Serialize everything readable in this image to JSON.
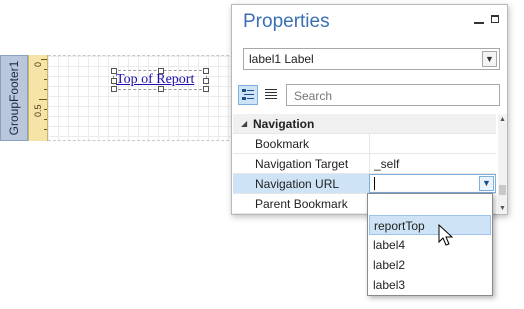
{
  "designer": {
    "band_name": "GroupFooter1",
    "ruler_marks": [
      "0",
      "0.5"
    ],
    "label_text": "Top of Report"
  },
  "panel": {
    "title": "Properties",
    "object_selector": "label1  Label",
    "search_placeholder": "Search",
    "category": "Navigation",
    "properties": [
      {
        "name": "Bookmark",
        "value": ""
      },
      {
        "name": "Navigation Target",
        "value": "_self"
      },
      {
        "name": "Navigation URL",
        "value": ""
      },
      {
        "name": "Parent Bookmark",
        "value": ""
      }
    ]
  },
  "dropdown": {
    "items": [
      "",
      "reportTop",
      "label4",
      "label2",
      "label3"
    ],
    "hovered": "reportTop"
  },
  "colors": {
    "accent": "#3a6fb4",
    "selection": "#cfe3f6",
    "band": "#b9c6dc",
    "ruler": "#f6e3a8"
  }
}
